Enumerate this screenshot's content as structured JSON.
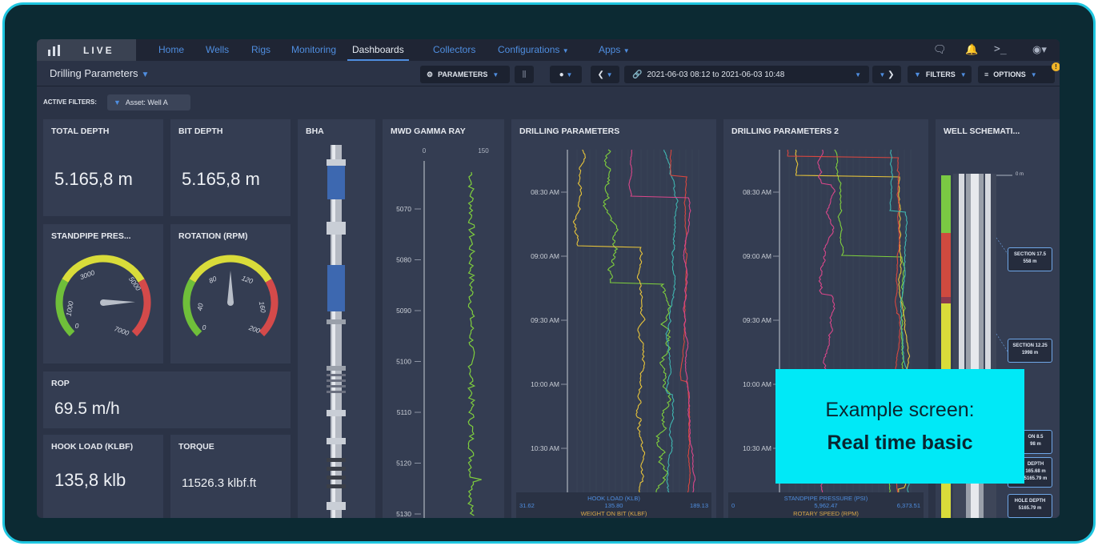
{
  "app": {
    "brand": "LIVE"
  },
  "nav": {
    "items": [
      {
        "label": "Home"
      },
      {
        "label": "Wells"
      },
      {
        "label": "Rigs"
      },
      {
        "label": "Monitoring"
      },
      {
        "label": "Dashboards"
      },
      {
        "label": "Collectors"
      },
      {
        "label": "Configurations"
      },
      {
        "label": "Apps"
      }
    ],
    "active": "Dashboards",
    "icons": [
      "chat-icon",
      "bell-icon",
      "terminal-icon",
      "user-icon"
    ]
  },
  "toolbar": {
    "dashboard_title": "Drilling Parameters",
    "parameters_label": "PARAMETERS",
    "time_range": "2021-06-03 08:12 to 2021-06-03 10:48",
    "filters_label": "FILTERS",
    "options_label": "OPTIONS",
    "options_badge": "!"
  },
  "filters": {
    "label": "ACTIVE FILTERS:",
    "chip": "Asset: Well A"
  },
  "widgets": {
    "total_depth": {
      "title": "TOTAL DEPTH",
      "value": "5.165,8 m"
    },
    "bit_depth": {
      "title": "BIT DEPTH",
      "value": "5.165,8 m"
    },
    "standpipe": {
      "title": "STANDPIPE PRES...",
      "ticks": [
        "1000",
        "3000",
        "5000",
        "0",
        "7000"
      ],
      "value": 5800,
      "max": 7000
    },
    "rotation": {
      "title": "ROTATION (RPM)",
      "ticks": [
        "40",
        "80",
        "120",
        "160",
        "0",
        "200"
      ],
      "value": 100,
      "max": 200
    },
    "rop": {
      "title": "ROP",
      "value": "69.5 m/h"
    },
    "hook_load": {
      "title": "HOOK LOAD (KLBF)",
      "value": "135,8 klb"
    },
    "torque": {
      "title": "TORQUE",
      "value": "11526.3 klbf.ft"
    },
    "bha": {
      "title": "BHA"
    },
    "gamma": {
      "title": "MWD GAMMA RAY",
      "scale_min": "0",
      "scale_max": "150",
      "depths": [
        "5070",
        "5080",
        "5090",
        "5100",
        "5110",
        "5120",
        "5130"
      ]
    },
    "drilling1": {
      "title": "DRILLING PARAMETERS",
      "times": [
        "08:30 AM",
        "09:00 AM",
        "09:30 AM",
        "10:00 AM",
        "10:30 AM"
      ],
      "legend": {
        "name": "HOOK LOAD (KLB)",
        "min": "31.62",
        "current": "135.80",
        "max": "189.13",
        "next": "WEIGHT ON BIT (KLBF)"
      }
    },
    "drilling2": {
      "title": "DRILLING PARAMETERS 2",
      "times": [
        "08:30 AM",
        "09:00 AM",
        "09:30 AM",
        "10:00 AM",
        "10:30 AM"
      ],
      "legend": {
        "name": "STANDPIPE PRESSURE (PSI)",
        "min": "0",
        "current": "5,962.47",
        "max": "6,373.51",
        "next": "ROTARY SPEED (RPM)"
      }
    },
    "schematic": {
      "title": "WELL SCHEMATI...",
      "top_label": "0 m",
      "sections": [
        {
          "name": "SECTION 17.5",
          "depth": "558 m"
        },
        {
          "name": "SECTION 12.25",
          "depth": "1998 m"
        },
        {
          "name": "ON 8.5",
          "depth": "98 m"
        },
        {
          "name": "DEPTH",
          "depth": "165.68 m"
        },
        {
          "name": "",
          "depth": "5165.79 m"
        },
        {
          "name": "HOLE DEPTH",
          "depth": "5165.79 m"
        }
      ]
    }
  },
  "callout": {
    "line1": "Example screen:",
    "line2": "Real time basic"
  },
  "colors": {
    "frame_border": "#1fc6e0",
    "accent": "#4f8ee0",
    "callout_bg": "#00e9f7",
    "gauge_green": "#6fbf3a",
    "gauge_yellow": "#d9dc3a",
    "gauge_red": "#d44a4a"
  }
}
